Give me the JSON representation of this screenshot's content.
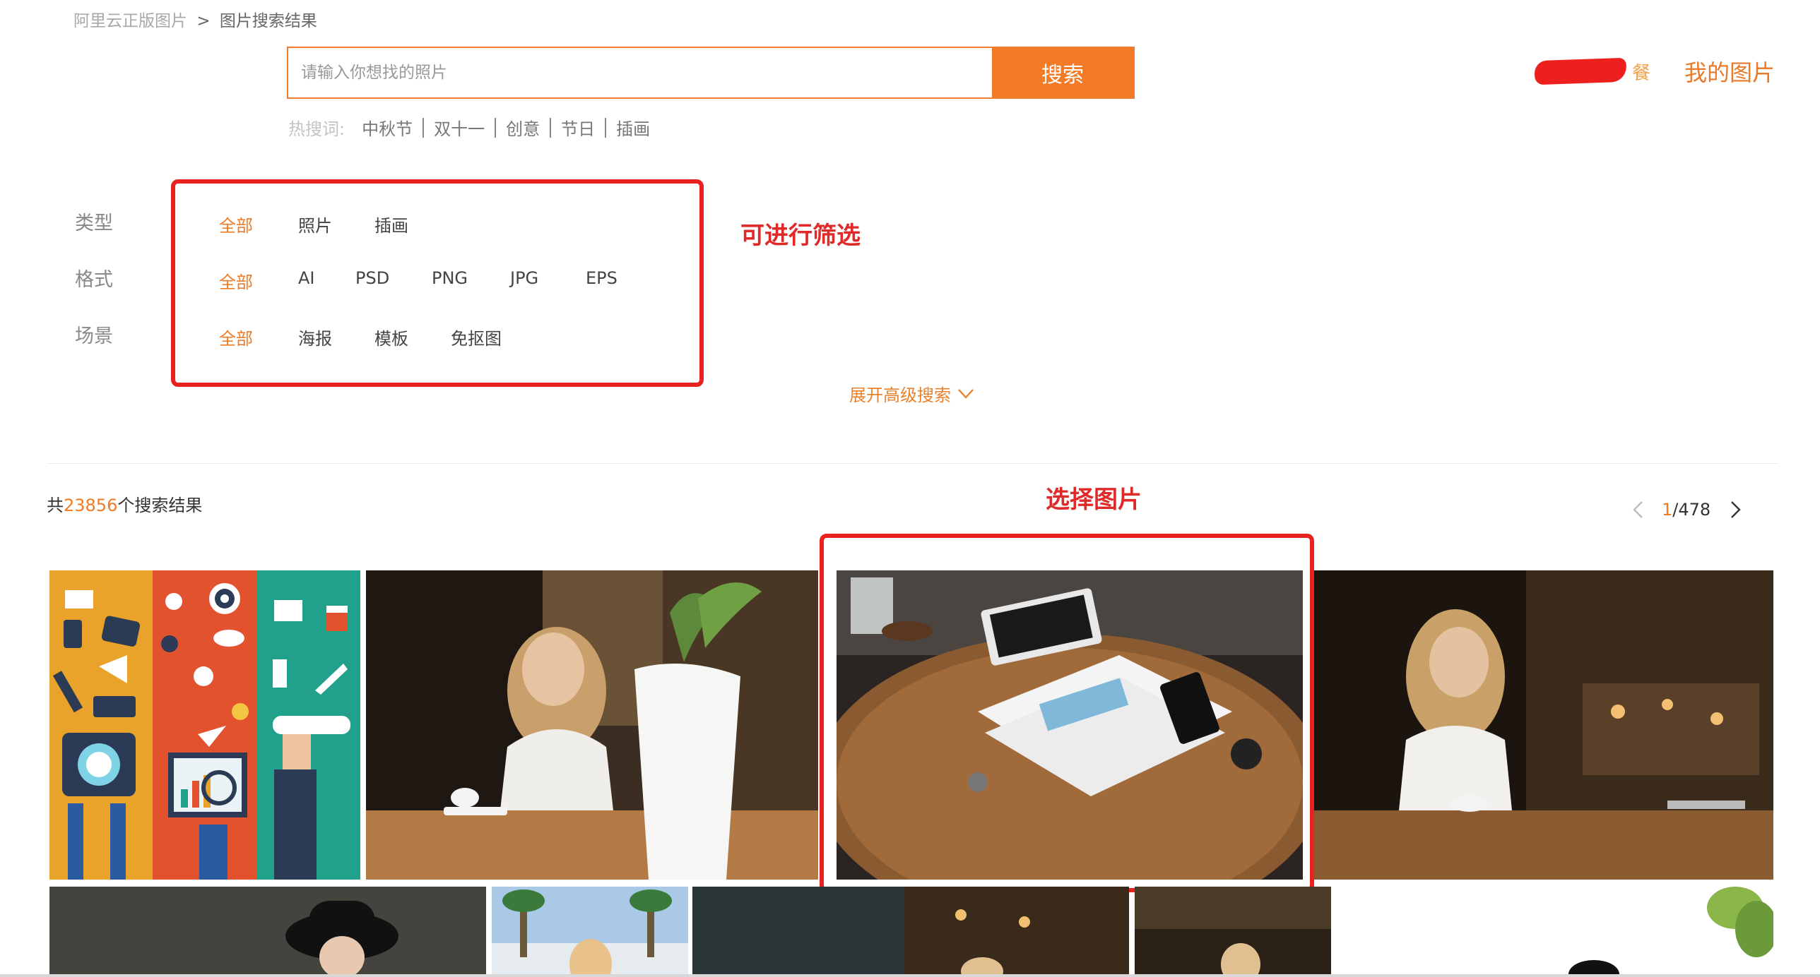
{
  "breadcrumb": {
    "root": "阿里云正版图片",
    "separator": ">",
    "current": "图片搜索结果"
  },
  "search": {
    "placeholder": "请输入你想找的照片",
    "value": "",
    "button_label": "搜索"
  },
  "hot_words": {
    "label": "热搜词:",
    "items": [
      "中秋节",
      "双十一",
      "创意",
      "节日",
      "插画"
    ]
  },
  "user": {
    "redacted_suffix": "餐",
    "my_images_label": "我的图片"
  },
  "filters": {
    "type": {
      "label": "类型",
      "options": [
        "全部",
        "照片",
        "插画"
      ],
      "selected": "全部"
    },
    "format": {
      "label": "格式",
      "options": [
        "全部",
        "AI",
        "PSD",
        "PNG",
        "JPG",
        "EPS"
      ],
      "selected": "全部"
    },
    "scene": {
      "label": "场景",
      "options": [
        "全部",
        "海报",
        "模板",
        "免抠图"
      ],
      "selected": "全部"
    }
  },
  "advanced_search_label": "展开高级搜索",
  "annotations": {
    "filter_note": "可进行筛选",
    "select_note": "选择图片"
  },
  "results": {
    "prefix": "共",
    "count": "23856",
    "suffix": "个搜索结果"
  },
  "pagination": {
    "current": "1",
    "separator": "/",
    "total": "478"
  },
  "colors": {
    "accent": "#f37b25",
    "annotation": "#e8231f"
  },
  "icons": {
    "advanced_toggle": "chevron-down-icon",
    "prev_page": "chevron-left-icon",
    "next_page": "chevron-right-icon"
  },
  "images": [
    {
      "name": "image-infographic-illustration"
    },
    {
      "name": "image-woman-phone-cafe"
    },
    {
      "name": "image-table-tablet-documents"
    },
    {
      "name": "image-woman-phone-cafe-2"
    },
    {
      "name": "image-woman-hat"
    },
    {
      "name": "image-woman-outdoor"
    },
    {
      "name": "image-dark-cafe"
    },
    {
      "name": "image-woman-cafe-small"
    },
    {
      "name": "image-white-plant"
    }
  ]
}
